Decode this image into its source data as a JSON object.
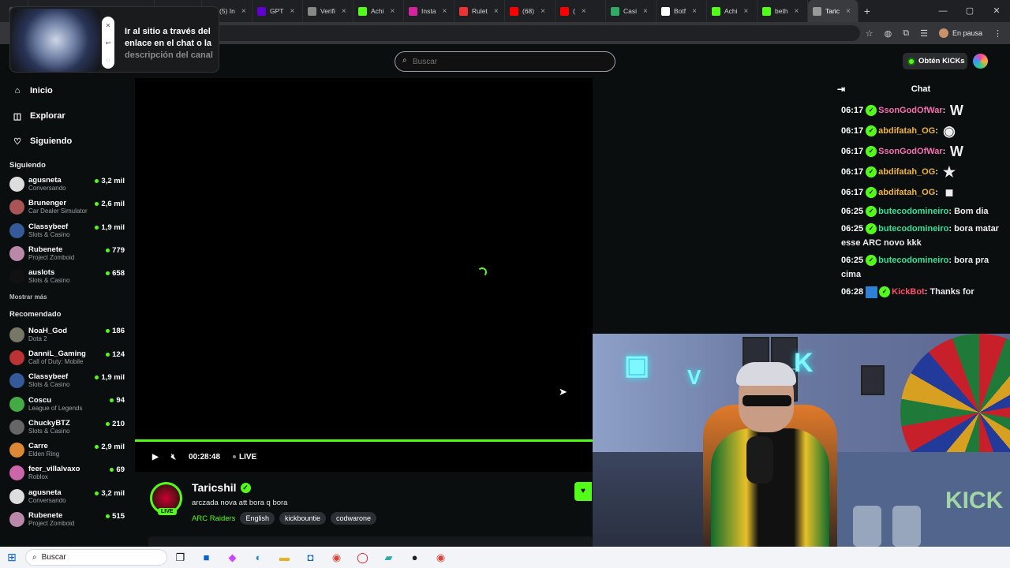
{
  "browser": {
    "tabs": [
      {
        "label": "",
        "color": "#555"
      },
      {
        "label": "",
        "color": "#444"
      },
      {
        "label": "",
        "color": "#c33"
      },
      {
        "label": "(5) In",
        "color": "#d6249f"
      },
      {
        "label": "GPT",
        "color": "#6001d2"
      },
      {
        "label": "Verifi",
        "color": "#888"
      },
      {
        "label": "Achi",
        "color": "#53fc18"
      },
      {
        "label": "Insta",
        "color": "#d6249f"
      },
      {
        "label": "Rulet",
        "color": "#e33"
      },
      {
        "label": "(68)",
        "color": "#f00"
      },
      {
        "label": "(",
        "color": "#f00"
      },
      {
        "label": "Casi",
        "color": "#3a6"
      },
      {
        "label": "Botf",
        "color": "#fff"
      },
      {
        "label": "Achi",
        "color": "#53fc18"
      },
      {
        "label": "beth",
        "color": "#53fc18"
      },
      {
        "label": "Taric",
        "color": "#999",
        "active": true
      }
    ],
    "new_tab": "+",
    "window_controls": [
      "—",
      "▢",
      "✕"
    ],
    "paused_label": "En pausa"
  },
  "popup": {
    "line1": "Ir al sitio a través del",
    "line2": "enlace en el chat o la",
    "line3": "descripción del canal"
  },
  "header": {
    "search_placeholder": "Buscar",
    "kicks_label": "Obtén KICKs"
  },
  "sidebar": {
    "nav": [
      {
        "label": "Inicio",
        "icon": "home-icon",
        "glyph": "⌂"
      },
      {
        "label": "Explorar",
        "icon": "browse-icon",
        "glyph": "◫"
      },
      {
        "label": "Siguiendo",
        "icon": "heart-icon",
        "glyph": "♡"
      }
    ],
    "following_title": "Siguiendo",
    "following": [
      {
        "name": "agusneta",
        "category": "Conversando",
        "viewers": "3,2 mil",
        "color": "#ddd"
      },
      {
        "name": "Brunenger",
        "category": "Car Dealer Simulator",
        "viewers": "2,6 mil",
        "color": "#a55"
      },
      {
        "name": "Classybeef",
        "category": "Slots & Casino",
        "viewers": "1,9 mil",
        "color": "#355a9a"
      },
      {
        "name": "Rubenete",
        "category": "Project Zomboid",
        "viewers": "779",
        "color": "#b8a"
      },
      {
        "name": "auslots",
        "category": "Slots & Casino",
        "viewers": "658",
        "color": "#111"
      }
    ],
    "more_label": "Mostrar más",
    "recommended_title": "Recomendado",
    "recommended": [
      {
        "name": "NoaH_God",
        "category": "Dota 2",
        "viewers": "186",
        "color": "#776"
      },
      {
        "name": "DanniL_Gaming",
        "category": "Call of Duty: Mobile",
        "viewers": "124",
        "color": "#b33"
      },
      {
        "name": "Classybeef",
        "category": "Slots & Casino",
        "viewers": "1,9 mil",
        "color": "#355a9a"
      },
      {
        "name": "Coscu",
        "category": "League of Legends",
        "viewers": "94",
        "color": "#4a4"
      },
      {
        "name": "ChuckyBTZ",
        "category": "Slots & Casino",
        "viewers": "210",
        "color": "#666"
      },
      {
        "name": "Carre",
        "category": "Elden Ring",
        "viewers": "2,9 mil",
        "color": "#d83"
      },
      {
        "name": "feer_villalvaxo",
        "category": "Roblox",
        "viewers": "69",
        "color": "#c6a"
      },
      {
        "name": "agusneta",
        "category": "Conversando",
        "viewers": "3,2 mil",
        "color": "#ddd"
      },
      {
        "name": "Rubenete",
        "category": "Project Zomboid",
        "viewers": "515",
        "color": "#b8a"
      }
    ]
  },
  "player": {
    "time": "00:28:48",
    "live": "LIVE",
    "progress": 1.0
  },
  "stream": {
    "streamer": "Taricshil",
    "live_badge": "LIVE",
    "title": "arczada nova att bora q bora",
    "category": "ARC Raiders",
    "tags": [
      "English",
      "kickbountie",
      "codwarone"
    ]
  },
  "chat": {
    "title": "Chat",
    "messages": [
      {
        "time": "06:17",
        "user": "SsonGodOfWar",
        "color": "#f86fb0",
        "text": "",
        "emote": "W"
      },
      {
        "time": "06:17",
        "user": "abdifatah_OG",
        "color": "#f0b43c",
        "text": "",
        "emote": "◉"
      },
      {
        "time": "06:17",
        "user": "SsonGodOfWar",
        "color": "#f86fb0",
        "text": "",
        "emote": "W"
      },
      {
        "time": "06:17",
        "user": "abdifatah_OG",
        "color": "#f0b43c",
        "text": "",
        "emote": "★"
      },
      {
        "time": "06:17",
        "user": "abdifatah_OG",
        "color": "#f0b43c",
        "text": "",
        "emote": "■"
      },
      {
        "time": "06:25",
        "user": "butecodomineiro",
        "color": "#2fe39a",
        "text": "Bom dia",
        "emote": ""
      },
      {
        "time": "06:25",
        "user": "butecodomineiro",
        "color": "#2fe39a",
        "text": "bora matar esse ARC novo kkk",
        "emote": ""
      },
      {
        "time": "06:25",
        "user": "butecodomineiro",
        "color": "#2fe39a",
        "text": "bora pra cima",
        "emote": ""
      },
      {
        "time": "06:28",
        "user": "KickBot",
        "color": "#ff4d6a",
        "text": "Thanks for",
        "emote": "",
        "bot": true
      }
    ]
  },
  "taskbar": {
    "search_label": "Buscar"
  }
}
